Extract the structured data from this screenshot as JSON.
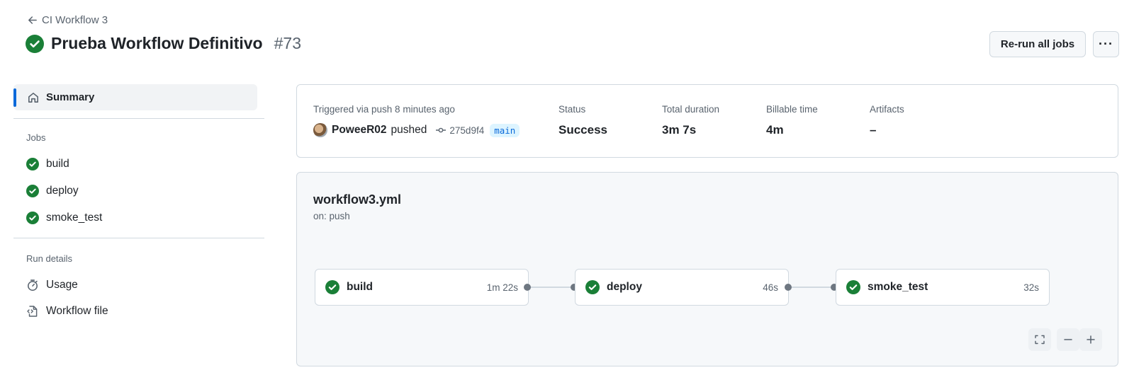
{
  "header": {
    "back_label": "CI Workflow 3",
    "title": "Prueba Workflow Definitivo",
    "run_number": "#73",
    "rerun_label": "Re-run all jobs",
    "more_label": "···"
  },
  "sidebar": {
    "summary_label": "Summary",
    "jobs_heading": "Jobs",
    "jobs": [
      {
        "label": "build",
        "status": "success"
      },
      {
        "label": "deploy",
        "status": "success"
      },
      {
        "label": "smoke_test",
        "status": "success"
      }
    ],
    "run_details_heading": "Run details",
    "usage_label": "Usage",
    "workflow_file_label": "Workflow file"
  },
  "summary": {
    "trigger_label": "Triggered via push 8 minutes ago",
    "user": "PoweeR02",
    "action": "pushed",
    "commit": "275d9f4",
    "branch": "main",
    "status_label": "Status",
    "status_value": "Success",
    "duration_label": "Total duration",
    "duration_value": "3m 7s",
    "billable_label": "Billable time",
    "billable_value": "4m",
    "artifacts_label": "Artifacts",
    "artifacts_value": "–"
  },
  "graph": {
    "workflow_file": "workflow3.yml",
    "trigger": "on: push",
    "jobs": [
      {
        "name": "build",
        "duration": "1m 22s"
      },
      {
        "name": "deploy",
        "duration": "46s"
      },
      {
        "name": "smoke_test",
        "duration": "32s"
      }
    ]
  },
  "colors": {
    "success": "#1a7f37",
    "accent": "#0969da",
    "border": "#d1d9e0",
    "muted": "#59636e"
  },
  "icons": {
    "back": "arrow-left-icon",
    "success": "check-circle-fill-icon",
    "summary": "home-icon",
    "usage": "stopwatch-icon",
    "workflow_file": "file-code-icon",
    "commit": "git-commit-icon",
    "fullscreen": "screen-full-icon",
    "zoom_out": "minus-icon",
    "zoom_in": "plus-icon"
  }
}
